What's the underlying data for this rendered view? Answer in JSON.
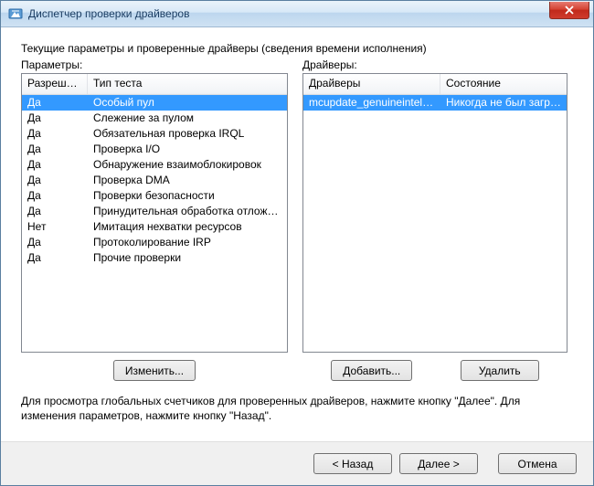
{
  "window": {
    "title": "Диспетчер проверки драйверов"
  },
  "main": {
    "subtitle": "Текущие параметры и проверенные драйверы (сведения времени исполнения)",
    "params_label": "Параметры:",
    "drivers_label": "Драйверы:",
    "params_cols": {
      "allowed": "Разреше...",
      "test_type": "Тип теста"
    },
    "drivers_cols": {
      "drivers": "Драйверы",
      "state": "Состояние"
    },
    "params_rows": [
      {
        "allowed": "Да",
        "test_type": "Особый пул"
      },
      {
        "allowed": "Да",
        "test_type": "Слежение за пулом"
      },
      {
        "allowed": "Да",
        "test_type": "Обязательная проверка IRQL"
      },
      {
        "allowed": "Да",
        "test_type": "Проверка I/O"
      },
      {
        "allowed": "Да",
        "test_type": "Обнаружение взаимоблокировок"
      },
      {
        "allowed": "Да",
        "test_type": "Проверка DMA"
      },
      {
        "allowed": "Да",
        "test_type": "Проверки безопасности"
      },
      {
        "allowed": "Да",
        "test_type": "Принудительная обработка отложен..."
      },
      {
        "allowed": "Нет",
        "test_type": "Имитация нехватки ресурсов"
      },
      {
        "allowed": "Да",
        "test_type": "Протоколирование IRP"
      },
      {
        "allowed": "Да",
        "test_type": "Прочие проверки"
      }
    ],
    "drivers_rows": [
      {
        "driver": "mcupdate_genuineintel.dll",
        "state": "Никогда не был загру..."
      }
    ],
    "buttons": {
      "change": "Изменить...",
      "add": "Добавить...",
      "delete": "Удалить"
    },
    "note": "Для просмотра глобальных счетчиков для проверенных драйверов, нажмите кнопку \"Далее\". Для изменения параметров, нажмите кнопку \"Назад\"."
  },
  "footer": {
    "back": "< Назад",
    "next": "Далее >",
    "cancel": "Отмена"
  }
}
